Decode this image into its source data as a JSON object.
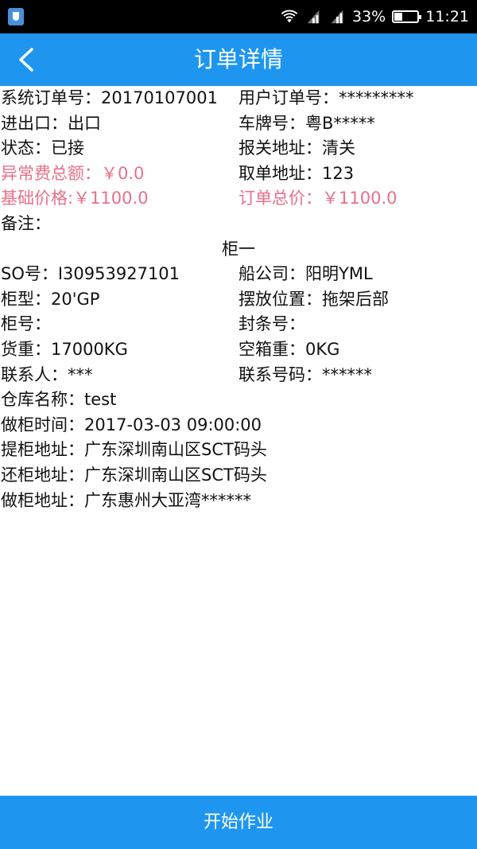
{
  "status_bar": {
    "battery_percent": "33%",
    "battery_level": 0.33,
    "time": "11:21"
  },
  "header": {
    "title": "订单详情"
  },
  "order": {
    "sys_order_no": "系统订单号：20170107001",
    "user_order_no": "用户订单号：*********",
    "import_export": "进出口：出口",
    "plate_no": "车牌号：粤B*****",
    "status": "状态：已接",
    "customs_address": "报关地址：清关",
    "abnormal_fee": "异常费总额：￥0.0",
    "pickup_doc_address": "取单地址：123",
    "base_price": "基础价格:￥1100.0",
    "total_price": "订单总价：￥1100.0",
    "remark": "备注："
  },
  "container": {
    "title": "柜一",
    "so_no": "SO号：I30953927101",
    "shipping_company": "船公司：阳明YML",
    "container_type": "柜型：20'GP",
    "placement": "摆放位置：拖架后部",
    "container_no": "柜号：",
    "seal_no": "封条号：",
    "cargo_weight": "货重：17000KG",
    "empty_weight": "空箱重：0KG",
    "contact": "联系人：***",
    "contact_phone": "联系号码：******",
    "warehouse": "仓库名称：test",
    "load_time": "做柜时间：2017-03-03 09:00:00",
    "pickup_address": "提柜地址：广东深圳南山区SCT码头",
    "return_address": "还柜地址：广东深圳南山区SCT码头",
    "load_address": "做柜地址：广东惠州大亚湾******"
  },
  "footer": {
    "start_button": "开始作业"
  },
  "colors": {
    "primary": "#1e96f0",
    "alert": "#e9708a"
  }
}
